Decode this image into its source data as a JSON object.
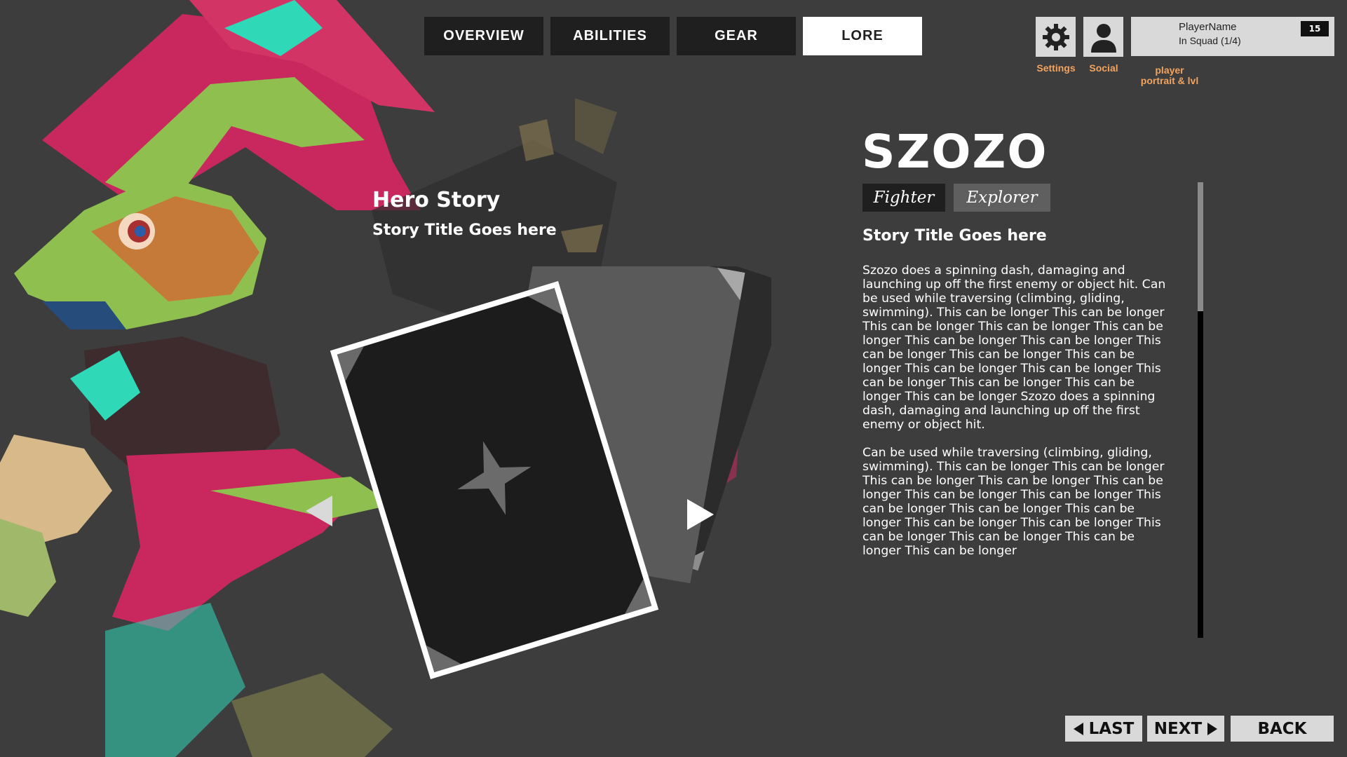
{
  "tabs": [
    {
      "label": "OVERVIEW",
      "active": false
    },
    {
      "label": "ABILITIES",
      "active": false
    },
    {
      "label": "GEAR",
      "active": false
    },
    {
      "label": "LORE",
      "active": true
    }
  ],
  "top_right": {
    "settings_label": "Settings",
    "social_label": "Social",
    "portrait_label_line1": "player",
    "portrait_label_line2": "portrait & lvl",
    "player_name": "PlayerName",
    "player_status": "In Squad (1/4)",
    "player_level": "15",
    "accent_color": "#f2a35e"
  },
  "story_panel": {
    "heading": "Hero Story",
    "subtitle": "Story Title Goes here",
    "icons": [
      "left-arrow-icon",
      "right-arrow-icon",
      "star-icon"
    ]
  },
  "hero": {
    "name": "SZOZO",
    "roles": [
      "Fighter",
      "Explorer"
    ],
    "story_title": "Story Title Goes here",
    "paragraph_1": "Szozo does a spinning dash, damaging and launching up off the first enemy or object hit. Can be used while traversing (climbing, gliding, swimming). This can be longer This can be longer This can be longer This can be longer This can be longer This can be longer This can be longer This can be longer This can be longer This can be longer This can be longer This can be longer This can be longer This can be longer This can be longer This can be longer  Szozo does a spinning dash, damaging and launching up off the first enemy or object hit.",
    "paragraph_2": "Can be used while traversing (climbing, gliding, swimming). This can be longer This can be longer This can be longer This can be longer This can be longer This can be longer This can be longer This can be longer This can be longer This can be longer This can be longer This can be longer This can be longer This can be longer This can be longer This can be longer"
  },
  "bottom": {
    "last_label": "LAST",
    "next_label": "NEXT",
    "back_label": "BACK"
  }
}
